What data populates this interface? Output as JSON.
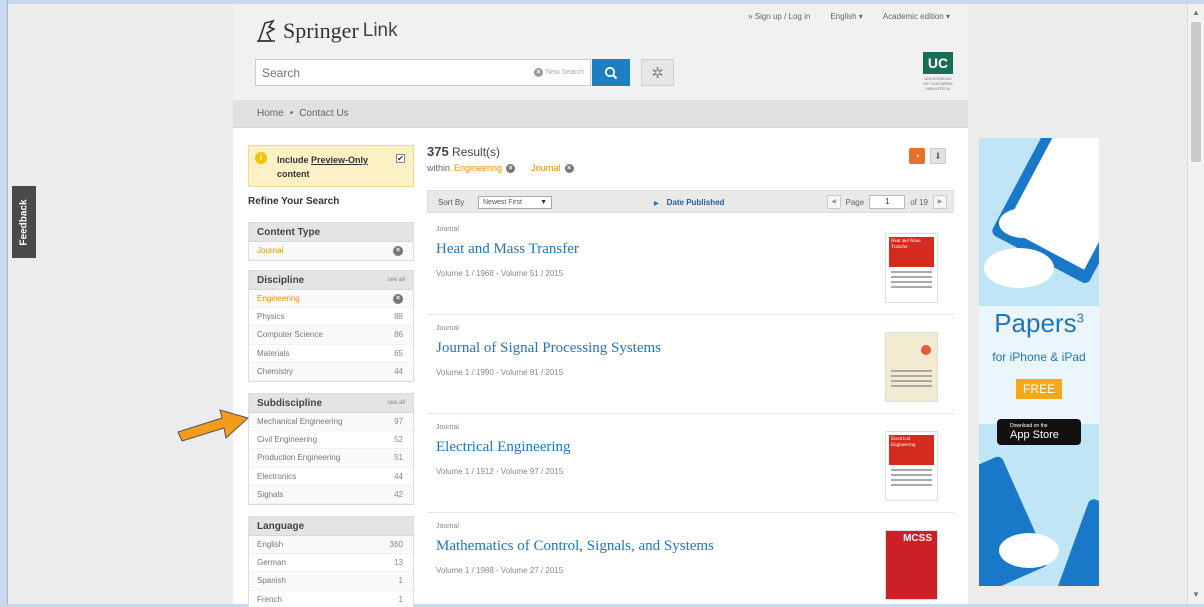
{
  "sidebar_tab": {
    "feedback_label": "Feedback"
  },
  "header": {
    "brand": "Springer",
    "brand_suffix": "Link",
    "top_links": [
      "» Sign up / Log in",
      "English ▾",
      "Academic edition ▾"
    ],
    "search_placeholder": "Search",
    "new_search_label": "New Search",
    "institution_logo": "UC",
    "institution_sub": "UNIVERSIDAD DE CANTABRIA BIBLIOTECA"
  },
  "breadcrumb": [
    "Home",
    "•",
    "Contact Us"
  ],
  "preview": {
    "text_prefix": "Include ",
    "text_link": "Preview-Only",
    "text_suffix": " content",
    "checked_mark": "✔"
  },
  "refine_title": "Refine Your Search",
  "facets": {
    "content_type": {
      "title": "Content Type",
      "items": [
        {
          "label": "Journal",
          "selected": true
        }
      ]
    },
    "discipline": {
      "title": "Discipline",
      "see_all": "see all",
      "items": [
        {
          "label": "Engineering",
          "selected": true
        },
        {
          "label": "Physics",
          "count": "88"
        },
        {
          "label": "Computer Science",
          "count": "86"
        },
        {
          "label": "Materials",
          "count": "65"
        },
        {
          "label": "Chemistry",
          "count": "44"
        }
      ]
    },
    "subdiscipline": {
      "title": "Subdiscipline",
      "see_all": "see all",
      "items": [
        {
          "label": "Mechanical Engineering",
          "count": "97"
        },
        {
          "label": "Civil Engineering",
          "count": "52"
        },
        {
          "label": "Production Engineering",
          "count": "51"
        },
        {
          "label": "Electronics",
          "count": "44"
        },
        {
          "label": "Signals",
          "count": "42"
        }
      ]
    },
    "language": {
      "title": "Language",
      "items": [
        {
          "label": "English",
          "count": "360"
        },
        {
          "label": "German",
          "count": "13"
        },
        {
          "label": "Spanish",
          "count": "1"
        },
        {
          "label": "French",
          "count": "1"
        }
      ]
    }
  },
  "results": {
    "count": "375",
    "count_label": "Result(s)",
    "within_label": "within",
    "filters": [
      "Engineering",
      "Journal"
    ],
    "sort_by_label": "Sort By",
    "sort_value": "Newest First",
    "date_published_label": "Date Published",
    "page_label": "Page",
    "page_value": "1",
    "page_of": "of 19",
    "items": [
      {
        "kind": "Journal",
        "title": "Heat and Mass Transfer",
        "volumes": "Volume 1 / 1968 - Volume 51 / 2015",
        "cover_text": "Heat and Mass Transfer"
      },
      {
        "kind": "Journal",
        "title": "Journal of Signal Processing Systems",
        "volumes": "Volume 1 / 1990 - Volume 81 / 2015",
        "cover_text": ""
      },
      {
        "kind": "Journal",
        "title": "Electrical Engineering",
        "volumes": "Volume 1 / 1912 - Volume 97 / 2015",
        "cover_text": "Electrical Engineering"
      },
      {
        "kind": "Journal",
        "title": "Mathematics of Control, Signals, and Systems",
        "volumes": "Volume 1 / 1988 - Volume 27 / 2015",
        "cover_text": "MCSS"
      }
    ]
  },
  "ad": {
    "title": "Papers",
    "title_sup": "3",
    "subtitle": "for iPhone & iPad",
    "free_label": "FREE",
    "appstore_small": "Download on the",
    "appstore_big": "App Store"
  },
  "icons": {
    "search": "search-icon",
    "gear": "gear-icon",
    "rss": "rss-icon",
    "download": "download-icon",
    "remove": "remove-filter-icon",
    "info": "info-icon",
    "arrow": "annotation-arrow-icon"
  },
  "colors": {
    "accent_blue": "#1f75bb",
    "accent_orange": "#f08a00",
    "search_button": "#1d7ec2",
    "arrow": "#f39c1b"
  }
}
